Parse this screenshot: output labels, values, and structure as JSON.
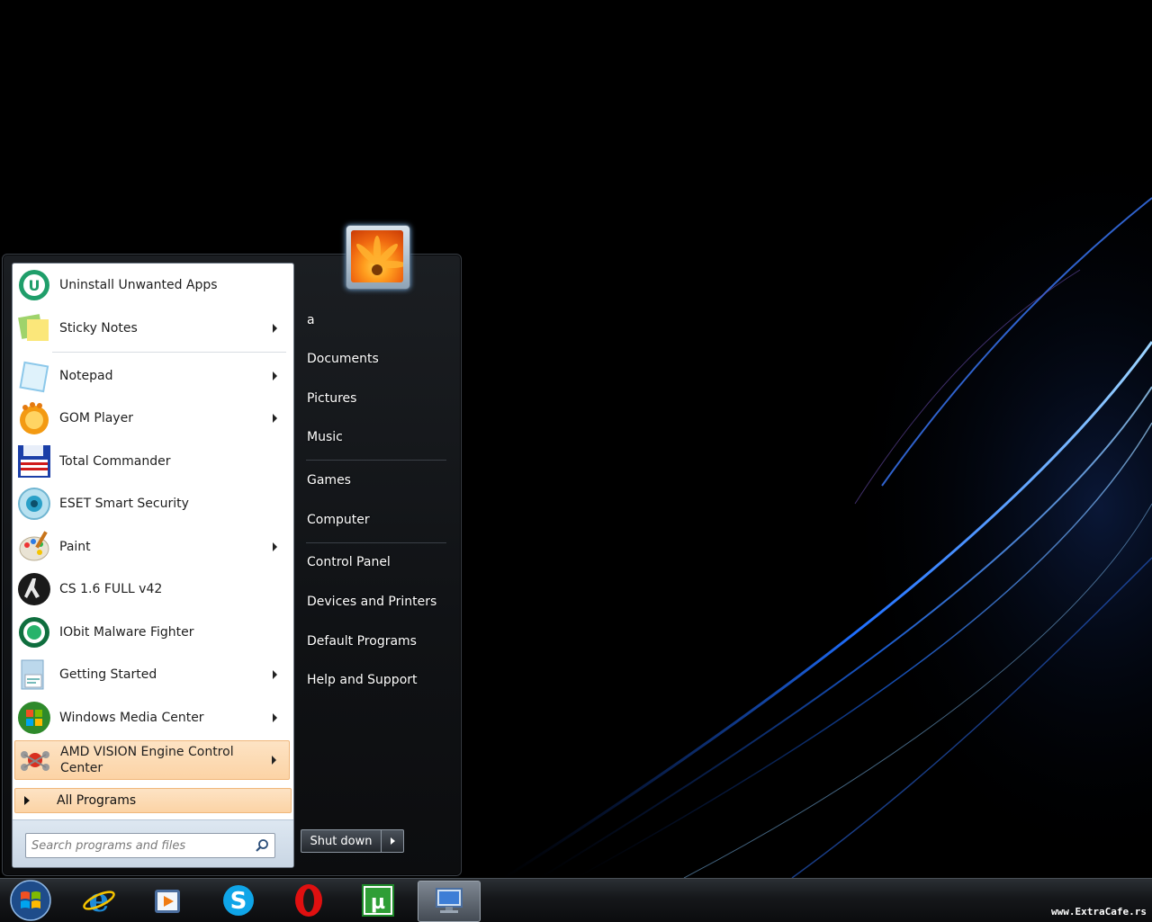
{
  "start_menu": {
    "programs": [
      {
        "label": "Uninstall Unwanted Apps",
        "icon": "uninstaller-icon",
        "submenu": false
      },
      {
        "label": "Sticky Notes",
        "icon": "sticky-notes-icon",
        "submenu": true
      },
      {
        "label": "Notepad",
        "icon": "notepad-icon",
        "submenu": true
      },
      {
        "label": "GOM Player",
        "icon": "gom-player-icon",
        "submenu": true
      },
      {
        "label": "Total Commander",
        "icon": "floppy-disk-icon",
        "submenu": false
      },
      {
        "label": "ESET Smart Security",
        "icon": "eset-eye-icon",
        "submenu": false
      },
      {
        "label": "Paint",
        "icon": "paint-palette-icon",
        "submenu": true
      },
      {
        "label": "CS 1.6 FULL v42",
        "icon": "counter-strike-icon",
        "submenu": false
      },
      {
        "label": "IObit Malware Fighter",
        "icon": "iobit-shield-icon",
        "submenu": false
      },
      {
        "label": "Getting Started",
        "icon": "getting-started-icon",
        "submenu": true
      },
      {
        "label": "Windows Media Center",
        "icon": "media-center-icon",
        "submenu": true
      },
      {
        "label": "AMD VISION Engine Control Center",
        "icon": "amd-vision-icon",
        "submenu": true,
        "highlighted": true
      }
    ],
    "all_programs_label": "All Programs",
    "search_placeholder": "Search programs and files",
    "right_links": {
      "user": "a",
      "documents": "Documents",
      "pictures": "Pictures",
      "music": "Music",
      "games": "Games",
      "computer": "Computer",
      "control_panel": "Control Panel",
      "devices_printers": "Devices and Printers",
      "default_programs": "Default Programs",
      "help_support": "Help and Support"
    },
    "shutdown_label": "Shut down"
  },
  "taskbar": {
    "items": [
      "start-orb-icon",
      "internet-explorer-icon",
      "media-player-icon",
      "skype-icon",
      "opera-icon",
      "utorrent-icon",
      "network-computer-icon"
    ],
    "active": "network-computer-icon"
  },
  "watermark": "www.ExtraCafe.rs",
  "colors": {
    "highlight": "#fcd3a5",
    "menu_dark": "#101215",
    "accent_blue": "#2e7bff"
  }
}
